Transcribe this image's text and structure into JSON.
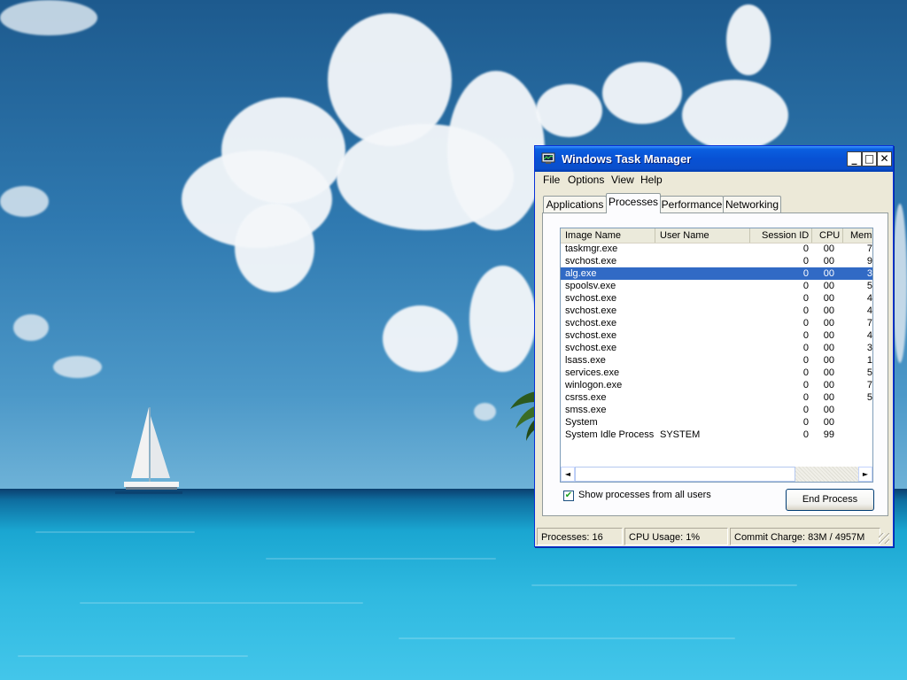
{
  "window": {
    "title": "Windows Task Manager",
    "title_color": "#0a5fe0",
    "minimize_glyph": "_",
    "maximize_glyph": "□",
    "close_glyph": "✕"
  },
  "menu": [
    "File",
    "Options",
    "View",
    "Help"
  ],
  "tabs": [
    {
      "label": "Applications",
      "active": false
    },
    {
      "label": "Processes",
      "active": true
    },
    {
      "label": "Performance",
      "active": false
    },
    {
      "label": "Networking",
      "active": false
    }
  ],
  "process_table": {
    "columns": [
      "Image Name",
      "User Name",
      "Session ID",
      "CPU",
      "Mem"
    ],
    "selected_row": 2,
    "selection_color": "#316ac5",
    "rows": [
      {
        "name": "taskmgr.exe",
        "user": "",
        "session": "0",
        "cpu": "00",
        "mem": "7"
      },
      {
        "name": "svchost.exe",
        "user": "",
        "session": "0",
        "cpu": "00",
        "mem": "9"
      },
      {
        "name": "alg.exe",
        "user": "",
        "session": "0",
        "cpu": "00",
        "mem": "3"
      },
      {
        "name": "spoolsv.exe",
        "user": "",
        "session": "0",
        "cpu": "00",
        "mem": "5"
      },
      {
        "name": "svchost.exe",
        "user": "",
        "session": "0",
        "cpu": "00",
        "mem": "4"
      },
      {
        "name": "svchost.exe",
        "user": "",
        "session": "0",
        "cpu": "00",
        "mem": "4"
      },
      {
        "name": "svchost.exe",
        "user": "",
        "session": "0",
        "cpu": "00",
        "mem": "7"
      },
      {
        "name": "svchost.exe",
        "user": "",
        "session": "0",
        "cpu": "00",
        "mem": "4"
      },
      {
        "name": "svchost.exe",
        "user": "",
        "session": "0",
        "cpu": "00",
        "mem": "3"
      },
      {
        "name": "lsass.exe",
        "user": "",
        "session": "0",
        "cpu": "00",
        "mem": "1"
      },
      {
        "name": "services.exe",
        "user": "",
        "session": "0",
        "cpu": "00",
        "mem": "5"
      },
      {
        "name": "winlogon.exe",
        "user": "",
        "session": "0",
        "cpu": "00",
        "mem": "7"
      },
      {
        "name": "csrss.exe",
        "user": "",
        "session": "0",
        "cpu": "00",
        "mem": "5"
      },
      {
        "name": "smss.exe",
        "user": "",
        "session": "0",
        "cpu": "00",
        "mem": ""
      },
      {
        "name": "System",
        "user": "",
        "session": "0",
        "cpu": "00",
        "mem": ""
      },
      {
        "name": "System Idle Process",
        "user": "SYSTEM",
        "session": "0",
        "cpu": "99",
        "mem": ""
      }
    ]
  },
  "show_all_users": {
    "checked": true,
    "label": "Show processes from all users"
  },
  "end_process_label": "End Process",
  "status": {
    "processes": "Processes: 16",
    "cpu_usage": "CPU Usage: 1%",
    "commit_charge": "Commit Charge: 83M / 4957M"
  },
  "icons": {
    "app": "task-manager-icon",
    "scroll_left": "◄",
    "scroll_right": "►",
    "check": "✔"
  }
}
